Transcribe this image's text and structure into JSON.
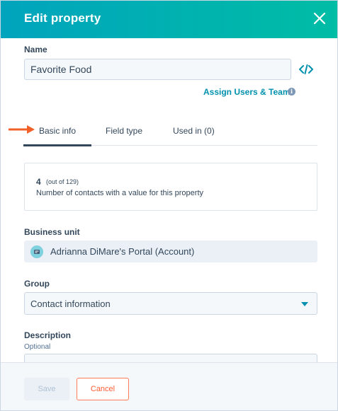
{
  "header": {
    "title": "Edit property",
    "close_icon": "close-icon"
  },
  "name_field": {
    "label": "Name",
    "value": "Favorite Food",
    "code_icon": "code-brackets-icon"
  },
  "assign_link": {
    "label": "Assign Users & Teams",
    "info_icon": "info-icon"
  },
  "tabs": [
    {
      "label": "Basic info",
      "active": true
    },
    {
      "label": "Field type",
      "active": false
    },
    {
      "label": "Used in (0)",
      "active": false
    }
  ],
  "stats": {
    "count": "4",
    "out_of": "(out of 129)",
    "description": "Number of contacts with a value for this property"
  },
  "business_unit": {
    "label": "Business unit",
    "value": "Adrianna DiMare's Portal (Account)"
  },
  "group": {
    "label": "Group",
    "selected": "Contact information"
  },
  "description": {
    "label": "Description",
    "sublabel": "Optional"
  },
  "footer": {
    "save_label": "Save",
    "cancel_label": "Cancel"
  },
  "colors": {
    "header_gradient_start": "#00a4bd",
    "header_gradient_end": "#00bda5",
    "link": "#0091ae",
    "cancel_border": "#ff7a59",
    "annotation_arrow": "#f2602a"
  }
}
